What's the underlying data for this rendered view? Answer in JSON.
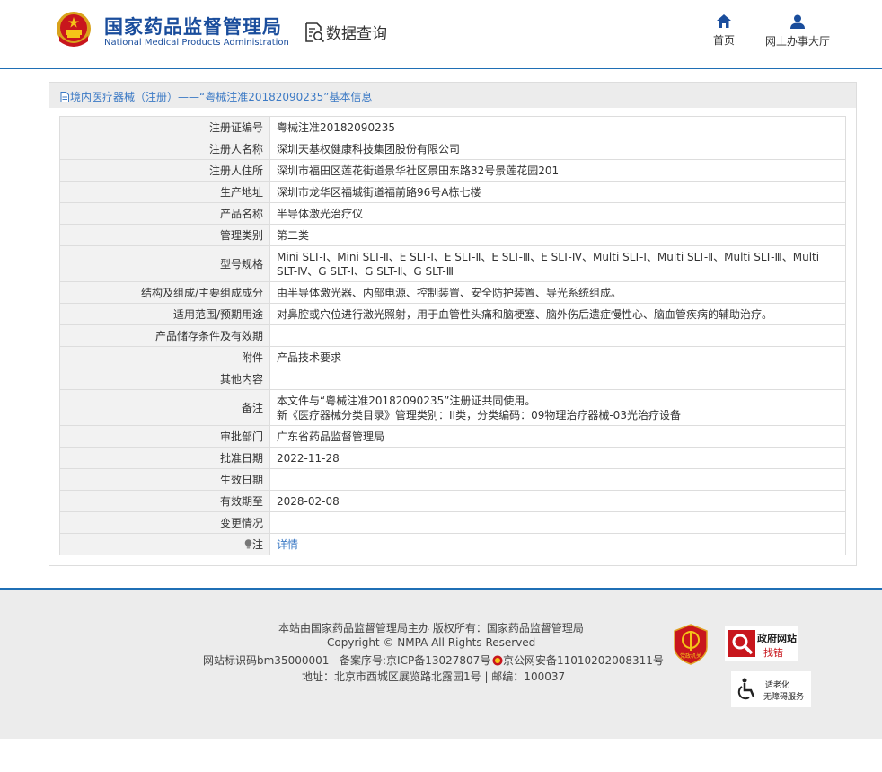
{
  "header": {
    "site_name_cn": "国家药品监督管理局",
    "site_name_en": "National Medical Products Administration",
    "section_title": "数据查询",
    "nav": [
      {
        "label": "首页",
        "icon": "home-icon"
      },
      {
        "label": "网上办事大厅",
        "icon": "user-icon"
      }
    ]
  },
  "breadcrumb": "境内医疗器械（注册）——“粤械注准20182090235”基本信息",
  "table": {
    "rows": [
      {
        "label": "注册证编号",
        "value": "粤械注准20182090235"
      },
      {
        "label": "注册人名称",
        "value": "深圳天基权健康科技集团股份有限公司"
      },
      {
        "label": "注册人住所",
        "value": "深圳市福田区莲花街道景华社区景田东路32号景莲花园201"
      },
      {
        "label": "生产地址",
        "value": "深圳市龙华区福城街道福前路96号A栋七楼"
      },
      {
        "label": "产品名称",
        "value": "半导体激光治疗仪"
      },
      {
        "label": "管理类别",
        "value": "第二类"
      },
      {
        "label": "型号规格",
        "value": "Mini SLT-Ⅰ、Mini SLT-Ⅱ、E SLT-Ⅰ、E SLT-Ⅱ、E SLT-Ⅲ、E SLT-Ⅳ、Multi SLT-Ⅰ、Multi SLT-Ⅱ、Multi SLT-Ⅲ、Multi SLT-Ⅳ、G SLT-Ⅰ、G SLT-Ⅱ、G SLT-Ⅲ"
      },
      {
        "label": "结构及组成/主要组成成分",
        "value": "由半导体激光器、内部电源、控制装置、安全防护装置、导光系统组成。"
      },
      {
        "label": "适用范围/预期用途",
        "value": "对鼻腔或穴位进行激光照射，用于血管性头痛和脑梗塞、脑外伤后遗症慢性心、脑血管疾病的辅助治疗。"
      },
      {
        "label": "产品储存条件及有效期",
        "value": ""
      },
      {
        "label": "附件",
        "value": "产品技术要求"
      },
      {
        "label": "其他内容",
        "value": ""
      },
      {
        "label": "备注",
        "value": "本文件与“粤械注准20182090235”注册证共同使用。",
        "value2": "新《医疗器械分类目录》管理类别：II类，分类编码：09物理治疗器械-03光治疗设备"
      },
      {
        "label": "审批部门",
        "value": "广东省药品监督管理局"
      },
      {
        "label": "批准日期",
        "value": "2022-11-28"
      },
      {
        "label": "生效日期",
        "value": ""
      },
      {
        "label": "有效期至",
        "value": "2028-02-08"
      },
      {
        "label": "变更情况",
        "value": ""
      },
      {
        "label": "注",
        "value": "详情"
      }
    ]
  },
  "footer": {
    "line1": "本站由国家药品监督管理局主办 版权所有：国家药品监督管理局",
    "line2": "Copyright © NMPA All Rights Reserved",
    "site_id": "网站标识码bm35000001",
    "icp": "备案序号:京ICP备13027807号",
    "police": "京公网安备11010202008311号",
    "address": "地址：北京市西城区展览路北露园1号 | 邮编：100037",
    "badge_gov": "党政机关",
    "badge_error_title": "政府网站",
    "badge_error_sub": "找错",
    "badge_access_title": "适老化",
    "badge_access_sub": "无障碍服务"
  }
}
